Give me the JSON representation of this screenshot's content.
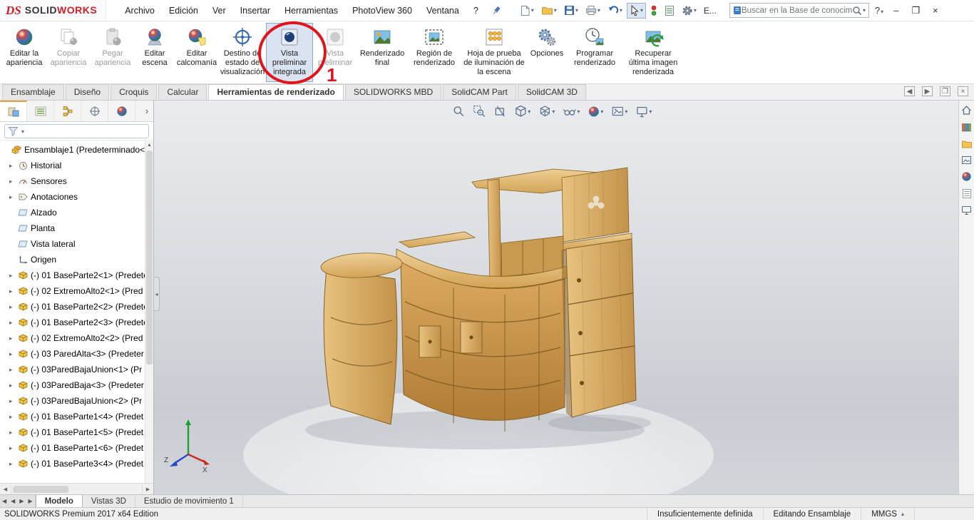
{
  "colors": {
    "annotation_red": "#e0151c",
    "selection_blue": "#d9e3f1",
    "wood_mid": "#c8924a",
    "accent_orange": "#e8a33d"
  },
  "icons": {
    "ds-logo-icon": "red DS monogram",
    "pin-icon": "pushpin",
    "new-document-icon": "blank page",
    "open-icon": "folder",
    "save-icon": "floppy disk",
    "print-icon": "printer",
    "undo-icon": "curved arrow",
    "select-cursor-icon": "pointer arrow",
    "traffic-light-icon": "red and green dots",
    "spreadsheet-icon": "sheet with lines",
    "gear-icon": "gear",
    "knowledge-base-icon": "small blue book",
    "search-icon": "magnifier",
    "help-icon": "question mark",
    "minimize-icon": "dash",
    "maximize-icon": "square",
    "close-icon": "x",
    "filter-icon": "funnel",
    "assembly-icon": "stacked yellow cubes",
    "part-icon": "yellow cube",
    "plane-icon": "parallelogram",
    "origin-icon": "axes arrows",
    "history-icon": "clock",
    "sensors-icon": "gauge",
    "annotations-icon": "tag",
    "zoom-fit-icon": "magnifier",
    "zoom-area-icon": "magnifier with dashed box",
    "section-view-icon": "cut cube",
    "view-orientation-icon": "cube",
    "display-style-icon": "wireframe cube",
    "hide-show-items-icon": "glasses",
    "appearance-ball-icon": "multicolored sphere",
    "apply-scene-icon": "landscape picture",
    "view-settings-icon": "monitor",
    "home-icon": "house",
    "design-library-icon": "books",
    "file-explorer-icon": "folder",
    "view-palette-icon": "picture",
    "appearances-icon": "multicolored sphere",
    "custom-properties-icon": "list sheet",
    "forum-icon": "monitor"
  },
  "titlebar": {
    "logo": {
      "ds": "DS",
      "solid": "SOLID",
      "works": "WORKS"
    },
    "menus": [
      "Archivo",
      "Edición",
      "Ver",
      "Insertar",
      "Herramientas",
      "PhotoView 360",
      "Ventana",
      "?"
    ],
    "extra": "E...",
    "search": {
      "placeholder": "Buscar en la Base de conocim"
    }
  },
  "ribbon": {
    "buttons": [
      {
        "label": "Editar la apariencia",
        "state": "enabled"
      },
      {
        "label": "Copiar apariencia",
        "state": "disabled"
      },
      {
        "label": "Pegar apariencia",
        "state": "disabled"
      },
      {
        "label": "Editar escena",
        "state": "enabled"
      },
      {
        "label": "Editar calcomanía",
        "state": "enabled"
      },
      {
        "label": "Destino de estado de visualización",
        "state": "enabled"
      },
      {
        "label": "Vista preliminar integrada",
        "state": "selected"
      },
      {
        "label": "Vista preliminar",
        "state": "disabled"
      },
      {
        "label": "Renderizado final",
        "state": "enabled"
      },
      {
        "label": "Región de renderizado",
        "state": "enabled"
      },
      {
        "label": "Hoja de prueba de iluminación de la escena",
        "state": "enabled"
      },
      {
        "label": "Opciones",
        "state": "enabled"
      },
      {
        "label": "Programar renderizado",
        "state": "enabled"
      },
      {
        "label": "Recuperar última imagen renderizada",
        "state": "enabled"
      }
    ],
    "annotation_number": "1"
  },
  "command_tabs": {
    "items": [
      "Ensamblaje",
      "Diseño",
      "Croquis",
      "Calcular",
      "Herramientas de renderizado",
      "SOLIDWORKS MBD",
      "SolidCAM Part",
      "SolidCAM 3D"
    ],
    "active": "Herramientas de renderizado"
  },
  "tree": {
    "items": [
      {
        "label": "Ensamblaje1 (Predeterminado<E",
        "type": "assembly"
      },
      {
        "label": "Historial",
        "type": "history"
      },
      {
        "label": "Sensores",
        "type": "sensors"
      },
      {
        "label": "Anotaciones",
        "type": "annotations"
      },
      {
        "label": "Alzado",
        "type": "plane"
      },
      {
        "label": "Planta",
        "type": "plane"
      },
      {
        "label": "Vista lateral",
        "type": "plane"
      },
      {
        "label": "Origen",
        "type": "origin"
      },
      {
        "label": "(-) 01 BaseParte2<1> (Predete",
        "type": "part"
      },
      {
        "label": "(-) 02 ExtremoAlto2<1> (Pred",
        "type": "part"
      },
      {
        "label": "(-) 01 BaseParte2<2> (Predete",
        "type": "part"
      },
      {
        "label": "(-) 01 BaseParte2<3> (Predete",
        "type": "part"
      },
      {
        "label": "(-) 02 ExtremoAlto2<2> (Pred",
        "type": "part"
      },
      {
        "label": "(-) 03 ParedAlta<3> (Predeter",
        "type": "part"
      },
      {
        "label": "(-) 03ParedBajaUnion<1> (Pr",
        "type": "part"
      },
      {
        "label": "(-) 03ParedBaja<3> (Predeter",
        "type": "part"
      },
      {
        "label": "(-) 03ParedBajaUnion<2> (Pr",
        "type": "part"
      },
      {
        "label": "(-) 01 BaseParte1<4> (Predet",
        "type": "part"
      },
      {
        "label": "(-) 01 BaseParte1<5> (Predet",
        "type": "part"
      },
      {
        "label": "(-) 01 BaseParte1<6> (Predet",
        "type": "part"
      },
      {
        "label": "(-) 01 BaseParte3<4> (Predet",
        "type": "part"
      }
    ]
  },
  "viewport": {
    "triad": {
      "x": "X",
      "z": "Z"
    }
  },
  "bottom_tabs": {
    "items": [
      "Modelo",
      "Vistas 3D",
      "Estudio de movimiento 1"
    ],
    "active": "Modelo"
  },
  "statusbar": {
    "left": "SOLIDWORKS Premium 2017 x64 Edition",
    "definition": "Insuficientemente definida",
    "mode": "Editando Ensamblaje",
    "units": "MMGS"
  }
}
